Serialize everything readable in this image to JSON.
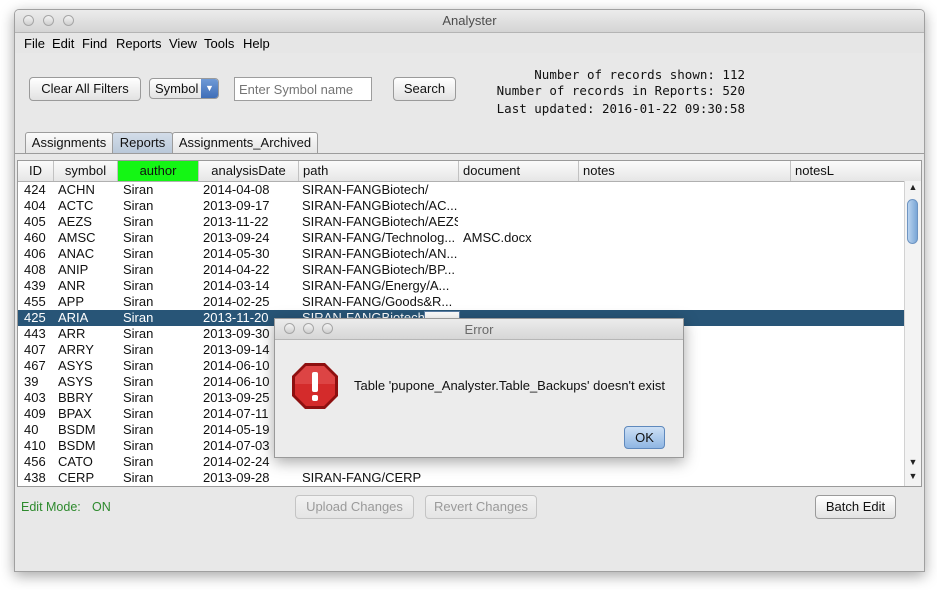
{
  "window": {
    "title": "Analyster"
  },
  "menu": [
    "File",
    "Edit",
    "Find",
    "Reports",
    "View",
    "Tools",
    "Help"
  ],
  "toolbar": {
    "clear_filters_label": "Clear All Filters",
    "symbol_select_value": "Symbol",
    "symbol_input_placeholder": "Enter Symbol name",
    "search_label": "Search"
  },
  "info": {
    "records_shown": "Number of records shown: 112",
    "records_total": "Number of records in Reports: 520",
    "last_updated": "Last updated: 2016-01-22 09:30:58"
  },
  "tabs": [
    {
      "label": "Assignments",
      "active": false
    },
    {
      "label": "Reports",
      "active": true
    },
    {
      "label": "Assignments_Archived",
      "active": false
    }
  ],
  "table": {
    "columns": [
      "ID",
      "symbol",
      "author",
      "analysisDate",
      "path",
      "document",
      "notes",
      "notesL"
    ],
    "highlight_color": "#14f614",
    "selected_color": "#285577",
    "rows": [
      [
        "424",
        "ACHN",
        "Siran",
        "2014-04-08",
        "SIRAN-FANGBiotech/",
        "",
        ""
      ],
      [
        "404",
        "ACTC",
        "Siran",
        "2013-09-17",
        "SIRAN-FANGBiotech/AC...",
        "",
        ""
      ],
      [
        "405",
        "AEZS",
        "Siran",
        "2013-11-22",
        "SIRAN-FANGBiotech/AEZS",
        "",
        ""
      ],
      [
        "460",
        "AMSC",
        "Siran",
        "2013-09-24",
        "SIRAN-FANG/Technolog...",
        "AMSC.docx",
        ""
      ],
      [
        "406",
        "ANAC",
        "Siran",
        "2014-05-30",
        "SIRAN-FANGBiotech/AN...",
        "",
        ""
      ],
      [
        "408",
        "ANIP",
        "Siran",
        "2014-04-22",
        "SIRAN-FANGBiotech/BP...",
        "",
        ""
      ],
      [
        "439",
        "ANR",
        "Siran",
        "2014-03-14",
        "SIRAN-FANG/Energy/A...",
        "",
        ""
      ],
      [
        "455",
        "APP",
        "Siran",
        "2014-02-25",
        "SIRAN-FANG/Goods&R...",
        "",
        ""
      ],
      [
        "425",
        "ARIA",
        "Siran",
        "2013-11-20",
        "SIRAN-FANGBiotech/",
        "",
        ""
      ],
      [
        "443",
        "ARR",
        "Siran",
        "2013-09-30",
        "",
        "",
        ""
      ],
      [
        "407",
        "ARRY",
        "Siran",
        "2013-09-14",
        "",
        "",
        ""
      ],
      [
        "467",
        "ASYS",
        "Siran",
        "2014-06-10",
        "",
        "",
        ""
      ],
      [
        "39",
        "ASYS",
        "Siran",
        "2014-06-10",
        "",
        "",
        ""
      ],
      [
        "403",
        "BBRY",
        "Siran",
        "2013-09-25",
        "",
        "",
        ""
      ],
      [
        "409",
        "BPAX",
        "Siran",
        "2014-07-11",
        "",
        "",
        ""
      ],
      [
        "40",
        "BSDM",
        "Siran",
        "2014-05-19",
        "",
        "",
        ""
      ],
      [
        "410",
        "BSDM",
        "Siran",
        "2014-07-03",
        "",
        "",
        ""
      ],
      [
        "456",
        "CATO",
        "Siran",
        "2014-02-24",
        "",
        "",
        ""
      ],
      [
        "438",
        "CERP",
        "Siran",
        "2013-09-28",
        "SIRAN-FANG/CERP",
        "",
        ""
      ]
    ],
    "selected_row": 8
  },
  "footer": {
    "edit_mode_label": "Edit Mode:",
    "edit_mode_value": "ON",
    "upload_label": "Upload Changes",
    "revert_label": "Revert Changes",
    "batch_edit_label": "Batch Edit"
  },
  "dialog": {
    "title": "Error",
    "message": "Table 'pupone_Analyster.Table_Backups' doesn't exist",
    "ok_label": "OK",
    "icon": "stop-icon"
  }
}
